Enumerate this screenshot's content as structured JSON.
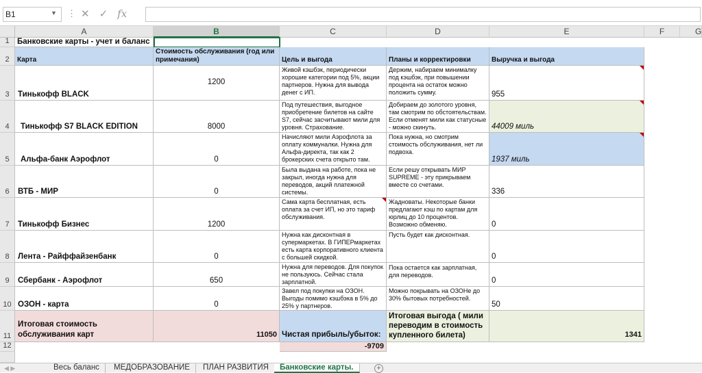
{
  "formula_bar": {
    "name_box": "B1",
    "fx_label": "fx",
    "formula": ""
  },
  "columns": [
    "A",
    "B",
    "C",
    "D",
    "E",
    "F",
    "G"
  ],
  "rows": [
    "1",
    "2",
    "3",
    "4",
    "5",
    "6",
    "7",
    "8",
    "9",
    "10",
    "11",
    "12"
  ],
  "title": "Банковские карты - учет и баланс",
  "headers": {
    "card": "Карта",
    "cost": "Стоимость обслуживания (год или примечания)",
    "goal": "Цель и выгода",
    "plans": "Планы и корректировки",
    "revenue": "Выручка и выгода"
  },
  "cards": [
    {
      "name": "Тинькофф BLACK",
      "cost": "1200",
      "goal": "Живой кэшбэк, периодически хорошие категории под 5%, акции партнеров. Нужна для вывода денег с ИП.",
      "plans": "Держим, набираем минималку под кэшбэк, при повышении процента на остаток можно положить сумму.",
      "revenue": "955"
    },
    {
      "name": "Тинькофф S7 BLACK EDITION",
      "cost": "8000",
      "goal": "Под путешествия, выгодное приобретение билетов на сайте S7, сейчас засчитывают мили для уровня. Страхование.",
      "plans": "Добираем до золотого уровня, там смотрим по обстоятельствам. Если отменят мили как статусные - можно скинуть.",
      "revenue": "44009 миль"
    },
    {
      "name": "Альфа-банк Аэрофлот",
      "cost": "0",
      "goal": "Начисляют мили Аэрофлота за оплату коммуналки. Нужна для Альфа-директа, так как 2 брокерских счета открыто там.",
      "plans": "Пока нужна, но смотрим стоимость обслуживания, нет ли подвоха.",
      "revenue": "1937 миль"
    },
    {
      "name": "ВТБ - МИР",
      "cost": "0",
      "goal": "Была выдана на работе, пока не закрыл, иногда нужна для переводов, акций платежной системы.",
      "plans": "Если решу открывать МИР SUPREME - эту прикрываем вместе со счетами.",
      "revenue": "336"
    },
    {
      "name": "Тинькофф Бизнес",
      "cost": "1200",
      "goal": "Сама карта бесплатная, есть оплата за счет ИП, но это тариф обслуживания.",
      "plans": "Жадноваты. Некоторые банки предлагают кэш по картам для юрлиц до 10 процентов. Возможно обменяю.",
      "revenue": "0"
    },
    {
      "name": "Лента - Райффайзенбанк",
      "cost": "0",
      "goal": "Нужна как дисконтная в супермаркетах. В ГИПЕРмаркетах есть карта корпоративного клиента с большей скидкой.",
      "plans": "Пусть будет как дисконтная.",
      "revenue": "0"
    },
    {
      "name": "Сбербанк - Аэрофлот",
      "cost": "650",
      "goal": "Нужна для переводов. Для покупок не пользуюсь. Сейчас стала зарплатной.",
      "plans": "Пока остается как зарплатная, для переводов.",
      "revenue": "0"
    },
    {
      "name": "ОЗОН - карта",
      "cost": "0",
      "goal": "Завел под покупки на ОЗОН. Выгоды помимо кэшбэка в 5% до 25% у партнеров.",
      "plans": "Можно покрывать на ОЗОНе до 30% бытовых потребностей.",
      "revenue": "50"
    }
  ],
  "totals": {
    "cost_label": "Итоговая стоимость обслуживания карт",
    "cost_value": "11050",
    "profit_label": "Чистая прибыль/убыток:",
    "profit_value": "-9709",
    "benefit_label": "Итоговая выгода ( мили переводим в стоимость купленного билета)",
    "benefit_value": "1341"
  },
  "sheet_tabs": [
    "Весь баланс",
    "МЕДОБРАЗОВАНИЕ",
    "ПЛАН РАЗВИТИЯ",
    "Банковские карты."
  ],
  "active_tab": "Банковские карты.",
  "colors": {
    "header_blue": "#c5d9f1",
    "green": "#ebf1de",
    "pink": "#f2dcdb",
    "accent": "#217346"
  }
}
